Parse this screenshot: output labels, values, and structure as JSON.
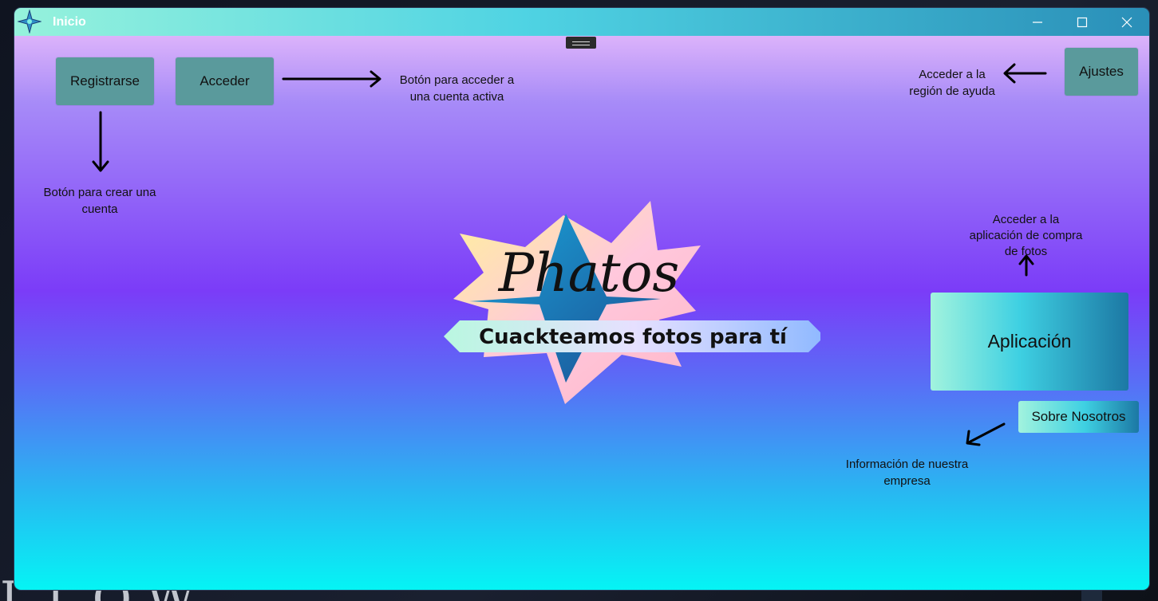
{
  "desktop": {
    "background_text": "LLOW KNIGHT"
  },
  "window": {
    "title": "Inicio",
    "controls": {
      "minimize_icon": "minimize-icon",
      "maximize_icon": "maximize-icon",
      "close_icon": "close-icon"
    }
  },
  "buttons": {
    "register": "Registrarse",
    "login": "Acceder",
    "settings": "Ajustes",
    "application": "Aplicación",
    "about": "Sobre Nosotros"
  },
  "annotations": {
    "login_note": [
      "Botón para acceder a",
      "una cuenta activa"
    ],
    "register_note": [
      "Botón para crear una",
      "cuenta"
    ],
    "settings_note": [
      "Acceder a la",
      "región de ayuda"
    ],
    "application_note": [
      "Acceder a la",
      "aplicación de compra",
      "de fotos"
    ],
    "about_note": [
      "Información de nuestra",
      "empresa"
    ]
  },
  "logo": {
    "name": "Phatos",
    "slogan": "Cuackteamos fotos para tí"
  },
  "colors": {
    "button_fill": "#5a9a9c",
    "titlebar_start": "#96f2dc",
    "titlebar_end": "#2a8fb8",
    "background_top": "#dcb3fa",
    "background_mid": "#7b3cf8",
    "background_bottom": "#05f4f4"
  }
}
